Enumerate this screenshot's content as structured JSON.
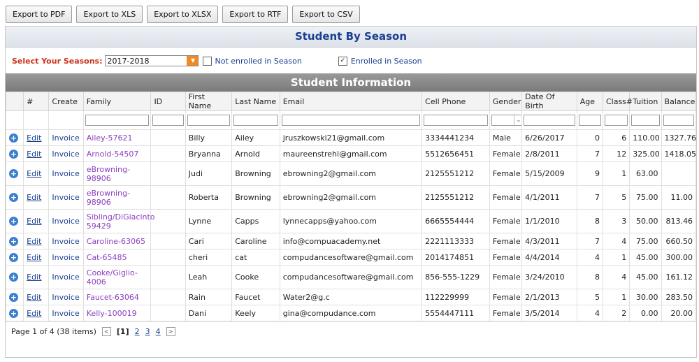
{
  "toolbar": {
    "buttons": [
      "Export to PDF",
      "Export to XLS",
      "Export to XLSX",
      "Export to RTF",
      "Export to CSV"
    ]
  },
  "season": {
    "title": "Student By Season",
    "select_label": "Select Your Seasons:",
    "selected": "2017-2018",
    "not_enrolled_label": "Not enrolled in Season",
    "enrolled_label": "Enrolled in Season"
  },
  "info": {
    "title": "Student Information",
    "columns": [
      "#",
      "Create",
      "Family",
      "ID",
      "First Name",
      "Last Name",
      "Email",
      "Cell Phone",
      "Gender",
      "Date Of Birth",
      "Age",
      "Class#",
      "Tuition",
      "Balance"
    ],
    "edit_label": "Edit",
    "invoice_label": "Invoice",
    "rows": [
      {
        "family": "Ailey-57621",
        "id": "",
        "first": "Billy",
        "last": "Ailey",
        "email": "jruszkowski21@gmail.com",
        "phone": "3334441234",
        "gender": "Male",
        "dob": "6/26/2017",
        "age": "0",
        "class": "6",
        "tuition": "110.00",
        "balance": "1327.76"
      },
      {
        "family": "Arnold-54507",
        "id": "",
        "first": "Bryanna",
        "last": "Arnold",
        "email": "maureenstrehl@gmail.com",
        "phone": "5512656451",
        "gender": "Female",
        "dob": "2/8/2011",
        "age": "7",
        "class": "12",
        "tuition": "325.00",
        "balance": "1418.05"
      },
      {
        "family": "eBrowning-98906",
        "id": "",
        "first": "Judi",
        "last": "Browning",
        "email": "ebrowning2@gmail.com",
        "phone": "2125551212",
        "gender": "Female",
        "dob": "5/15/2009",
        "age": "9",
        "class": "1",
        "tuition": "63.00",
        "balance": ""
      },
      {
        "family": "eBrowning-98906",
        "id": "",
        "first": "Roberta",
        "last": "Browning",
        "email": "ebrowning2@gmail.com",
        "phone": "2125551212",
        "gender": "Female",
        "dob": "4/1/2011",
        "age": "7",
        "class": "5",
        "tuition": "75.00",
        "balance": "11.00"
      },
      {
        "family": "Sibling/DiGiacinto 59429",
        "id": "",
        "first": "Lynne",
        "last": "Capps",
        "email": "lynnecapps@yahoo.com",
        "phone": "6665554444",
        "gender": "Female",
        "dob": "1/1/2010",
        "age": "8",
        "class": "3",
        "tuition": "50.00",
        "balance": "813.46"
      },
      {
        "family": "Caroline-63065",
        "id": "",
        "first": "Cari",
        "last": "Caroline",
        "email": "info@compuacademy.net",
        "phone": "2221113333",
        "gender": "Female",
        "dob": "4/3/2011",
        "age": "7",
        "class": "4",
        "tuition": "75.00",
        "balance": "660.50"
      },
      {
        "family": "Cat-65485",
        "id": "",
        "first": "cheri",
        "last": "cat",
        "email": "compudancesoftware@gmail.com",
        "phone": "2014174851",
        "gender": "Female",
        "dob": "4/4/2014",
        "age": "4",
        "class": "1",
        "tuition": "45.00",
        "balance": "300.00"
      },
      {
        "family": "Cooke/Giglio-4006",
        "id": "",
        "first": "Leah",
        "last": "Cooke",
        "email": "compudancesoftware@gmail.com",
        "phone": "856-555-1229",
        "gender": "Female",
        "dob": "3/24/2010",
        "age": "8",
        "class": "4",
        "tuition": "45.00",
        "balance": "161.12"
      },
      {
        "family": "Faucet-63064",
        "id": "",
        "first": "Rain",
        "last": "Faucet",
        "email": "Water2@g.c",
        "phone": "112229999",
        "gender": "Female",
        "dob": "2/1/2013",
        "age": "5",
        "class": "1",
        "tuition": "30.00",
        "balance": "283.50"
      },
      {
        "family": "Kelly-100019",
        "id": "",
        "first": "Dani",
        "last": "Keely",
        "email": "gina@compudance.com",
        "phone": "5554447111",
        "gender": "Female",
        "dob": "3/5/2014",
        "age": "4",
        "class": "2",
        "tuition": "0.00",
        "balance": "20.00"
      }
    ]
  },
  "pager": {
    "summary": "Page 1 of 4 (38 items)",
    "current": "[1]",
    "pages": [
      "2",
      "3",
      "4"
    ]
  }
}
